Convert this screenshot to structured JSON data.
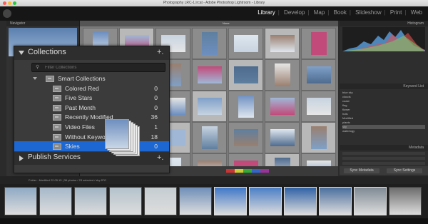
{
  "window": {
    "title": "Photography LRC-1.lrcat - Adobe Photoshop Lightroom - Library"
  },
  "modules": [
    "Library",
    "Develop",
    "Map",
    "Book",
    "Slideshow",
    "Print",
    "Web"
  ],
  "active_module": "Library",
  "left_panel": {
    "navigator_label": "Navigator"
  },
  "collections_panel": {
    "title": "Collections",
    "add_label": "+.",
    "search_placeholder": "Filter Collections",
    "search_icon": "search-icon",
    "rows": [
      {
        "label": "Smart Collections",
        "count": "",
        "type": "group"
      },
      {
        "label": "Colored Red",
        "count": "0",
        "type": "smart"
      },
      {
        "label": "Five Stars",
        "count": "0",
        "type": "smart"
      },
      {
        "label": "Past Month",
        "count": "0",
        "type": "smart"
      },
      {
        "label": "Recently Modified",
        "count": "36",
        "type": "smart"
      },
      {
        "label": "Video Files",
        "count": "1",
        "type": "smart"
      },
      {
        "label": "Without Keywords",
        "count": "18",
        "type": "smart"
      },
      {
        "label": "Skies",
        "count": "0",
        "type": "collection",
        "selected": true
      }
    ],
    "publish_title": "Publish Services",
    "publish_add_label": "+."
  },
  "right_panel": {
    "histogram_label": "Histogram",
    "keyword_list_label": "Keyword List",
    "metadata_label": "Metadata",
    "keywords": [
      "blue sky",
      "clouds",
      "coast",
      "flag",
      "flower",
      "huts",
      "Modified",
      "plants",
      "sky",
      "waterlogy"
    ],
    "sync_metadata": "Sync Metadata",
    "sync_settings": "Sync Settings"
  },
  "grid": {
    "view_label": "None"
  },
  "filmstrip": {
    "info": "Folder : Modified 22.05.15 | 36 photos / 23 selected / sky.JPG"
  },
  "colors": {
    "selection": "#1c67d2",
    "panel": "#3b3b3b",
    "active_module": "#ffffff"
  }
}
